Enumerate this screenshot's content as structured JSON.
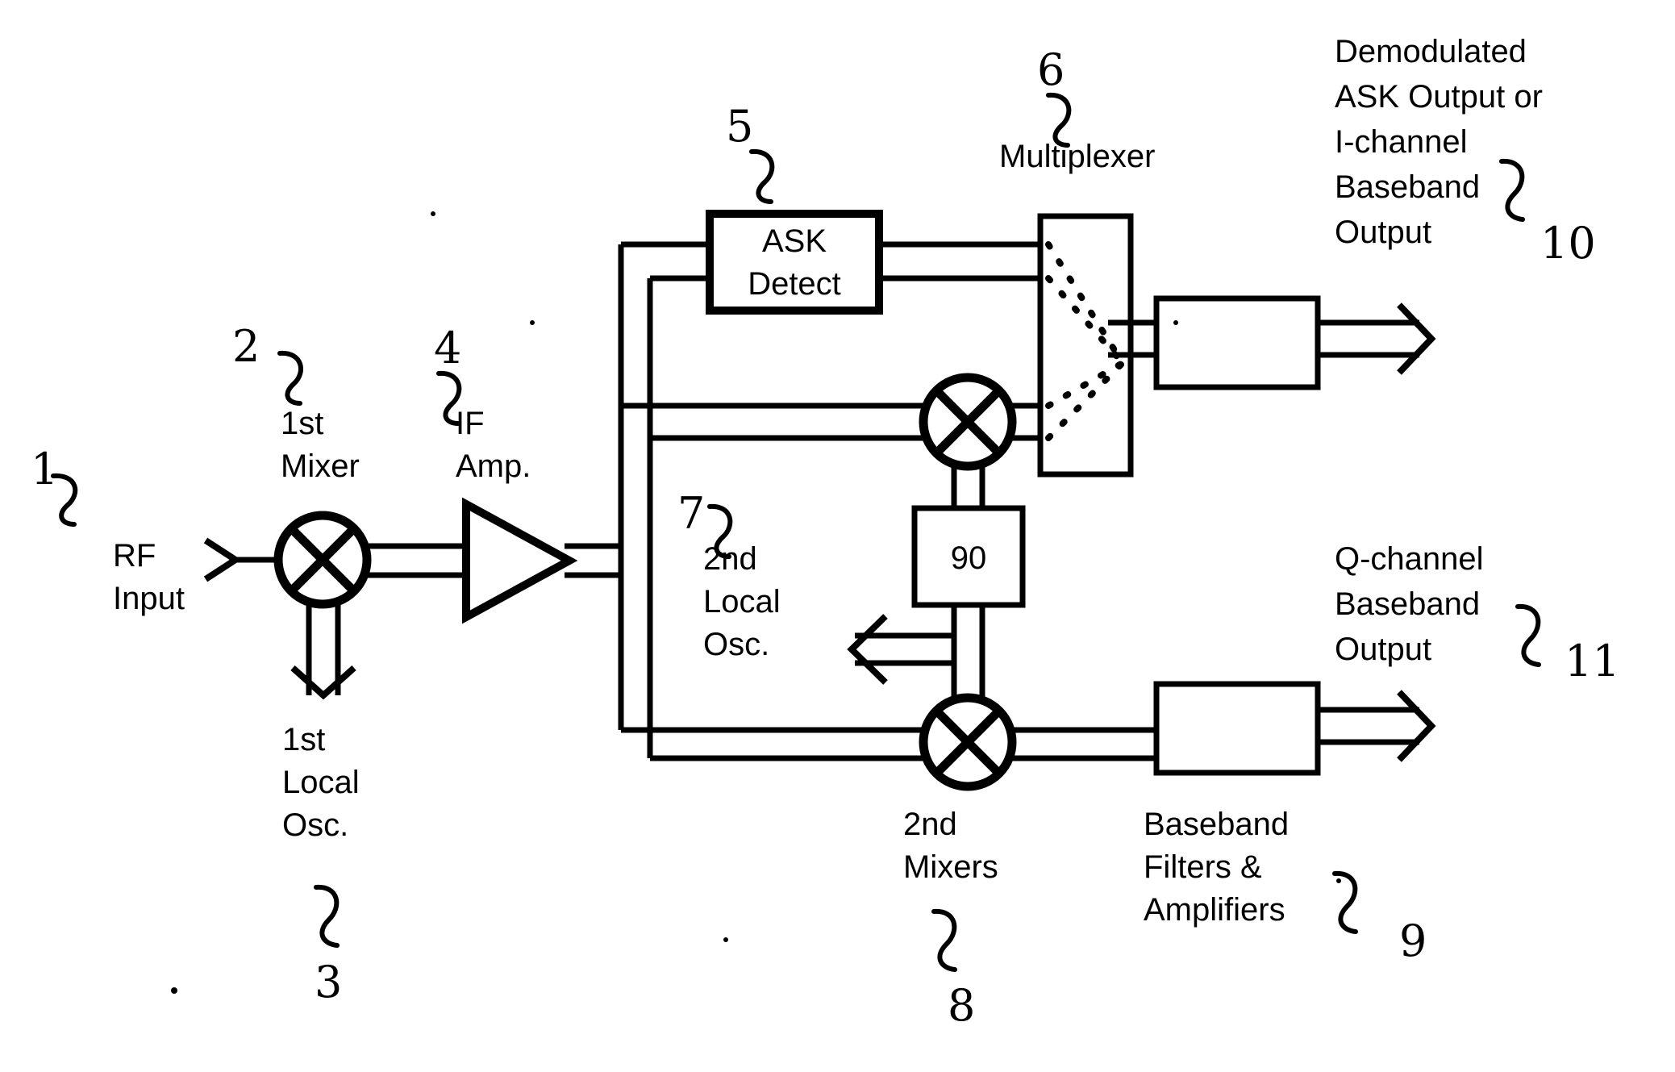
{
  "figure": {
    "type": "patent-block-diagram",
    "title": "Dual-conversion receiver with ASK detect and I/Q baseband outputs"
  },
  "blocks": {
    "ask_detect": {
      "line1": "ASK",
      "line2": "Detect",
      "ref": "5"
    },
    "phase_shifter": {
      "label": "90"
    },
    "multiplexer": {
      "label": "Multiplexer",
      "ref": "6"
    },
    "baseband_i": {
      "label": ""
    },
    "baseband_q": {
      "label": ""
    }
  },
  "labels": {
    "rf_input": {
      "line1": "RF",
      "line2": "Input",
      "ref": "1"
    },
    "first_mixer": {
      "line1": "1st",
      "line2": "Mixer",
      "ref": "2"
    },
    "first_local_osc": {
      "line1": "1st",
      "line2": "Local",
      "line3": "Osc.",
      "ref": "3"
    },
    "if_amp": {
      "line1": "IF",
      "line2": "Amp.",
      "ref": "4"
    },
    "second_local_osc": {
      "line1": "2nd",
      "line2": "Local",
      "line3": "Osc.",
      "ref": "7"
    },
    "second_mixers": {
      "line1": "2nd",
      "line2": "Mixers",
      "ref": "8"
    },
    "baseband_filters": {
      "line1": "Baseband",
      "line2": "Filters &",
      "line3": "Amplifiers",
      "ref": "9"
    },
    "i_output": {
      "line1": "Demodulated",
      "line2": "ASK Output or",
      "line3": "I-channel",
      "line4": "Baseband",
      "line5": "Output",
      "ref": "10"
    },
    "q_output": {
      "line1": "Q-channel",
      "line2": "Baseband",
      "line3": "Output",
      "ref": "11"
    }
  },
  "reference_numerals": [
    "1",
    "2",
    "3",
    "4",
    "5",
    "6",
    "7",
    "8",
    "9",
    "10",
    "11"
  ],
  "colors": {
    "ink": "#000000",
    "paper": "#ffffff"
  }
}
